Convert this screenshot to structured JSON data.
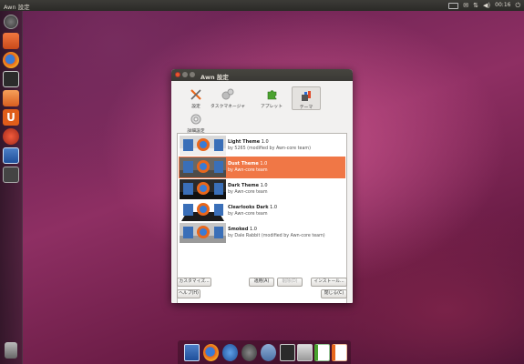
{
  "top_panel": {
    "title": "Awn 設定",
    "indicators": [
      "keyboard-icon",
      "mail-icon",
      "network-icon",
      "volume-icon"
    ],
    "clock": "00:16",
    "power": "⏻"
  },
  "window": {
    "title": "Awn 設定",
    "tabs": [
      {
        "id": "general",
        "label": "設定",
        "icon": "wrench-screwdriver-icon"
      },
      {
        "id": "taskmanager",
        "label": "タスクマネージャ",
        "icon": "gears-icon"
      },
      {
        "id": "applets",
        "label": "アプレット",
        "icon": "puzzle-icon"
      },
      {
        "id": "themes",
        "label": "テーマ",
        "icon": "paint-icon"
      },
      {
        "id": "advanced",
        "label": "詳細設定",
        "icon": "advanced-gear-icon"
      }
    ],
    "active_tab": "themes",
    "themes": [
      {
        "name": "Light Theme",
        "version": "1.0",
        "author": "by 5265 (modified by Awn-core team)",
        "style": "light",
        "selected": false
      },
      {
        "name": "Dust Theme",
        "version": "1.0",
        "author": "by Awn-core team",
        "style": "dust",
        "selected": true
      },
      {
        "name": "Dark Theme",
        "version": "1.0",
        "author": "by Awn-core team",
        "style": "dark",
        "selected": false
      },
      {
        "name": "Clearlooks Dark",
        "version": "1.0",
        "author": "by Awn-core team",
        "style": "clearlooks",
        "selected": false
      },
      {
        "name": "Smoked",
        "version": "1.0",
        "author": "by Dale Rabbit (modified by Awn-core team)",
        "style": "smoked",
        "selected": false
      }
    ],
    "buttons": {
      "customize": "カスタマイズ...",
      "apply": "適用(A)",
      "delete": "削除(D)",
      "install": "インストール...",
      "help": "ヘルプ(H)",
      "close": "閉じる(C)"
    }
  },
  "colors": {
    "selection": "#f07746",
    "panel": "#3c3b37"
  }
}
